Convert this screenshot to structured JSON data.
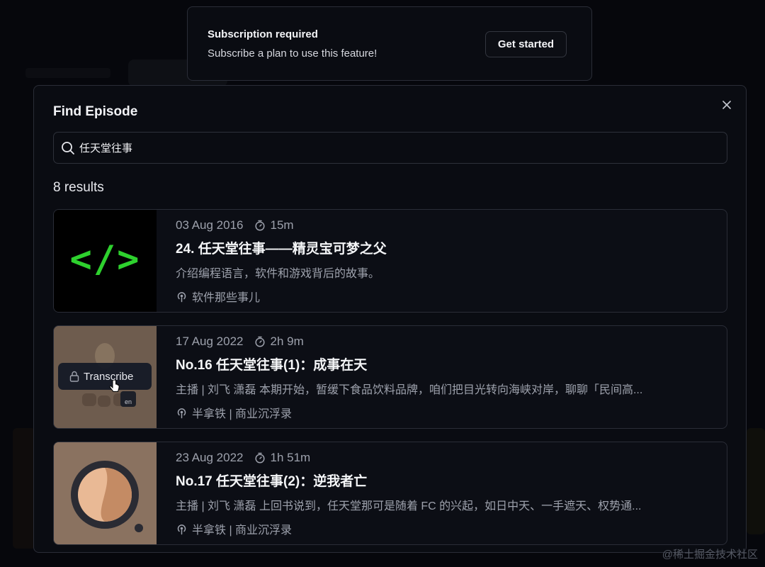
{
  "toast": {
    "title": "Subscription required",
    "message": "Subscribe a plan to use this feature!",
    "button_label": "Get started"
  },
  "dialog": {
    "title": "Find Episode",
    "search": {
      "value": "任天堂往事",
      "placeholder": ""
    },
    "results_count": "8 results",
    "results": [
      {
        "date": "03 Aug 2016",
        "duration": "15m",
        "title": "24. 任天堂往事——精灵宝可梦之父",
        "description": "介绍编程语言，软件和游戏背后的故事。",
        "podcast": "软件那些事儿",
        "thumb_icon": "code-brackets-logo",
        "thumb_text": "</>"
      },
      {
        "date": "17 Aug 2022",
        "duration": "2h 9m",
        "title": "No.16 任天堂往事(1)：成事在天",
        "description": "主播 | 刘飞 潇磊 本期开始，暂缓下食品饮料品牌，咱们把目光转向海峡对岸，聊聊「民间高...",
        "podcast": "半拿铁 | 商业沉浮录",
        "transcribe_label": "Transcribe",
        "translate_badge": "en"
      },
      {
        "date": "23 Aug 2022",
        "duration": "1h 51m",
        "title": "No.17 任天堂往事(2)：逆我者亡",
        "description": "主播 | 刘飞 潇磊 上回书说到，任天堂那可是随着 FC 的兴起，如日中天、一手遮天、权势通...",
        "podcast": "半拿铁 | 商业沉浮录"
      }
    ]
  },
  "watermark": "@稀土掘金技术社区",
  "colors": {
    "background": "#0b0d14",
    "panel": "#0a0c12",
    "border": "#2a2d37",
    "code_green": "#2ed12e",
    "thumb_tan": "#8a7260",
    "muted_text": "#9da1ac"
  }
}
